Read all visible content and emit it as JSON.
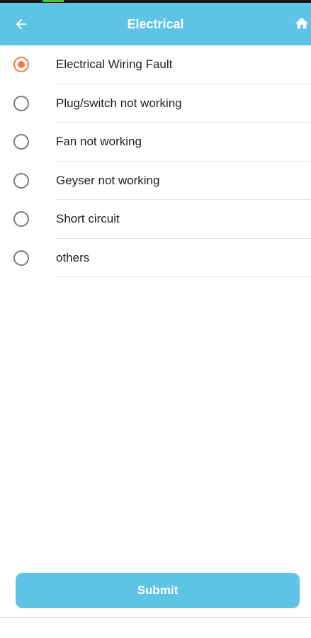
{
  "header": {
    "title": "Electrical",
    "background_color": "#5ec4e6",
    "back_icon": "arrow-left-icon",
    "home_icon": "home-icon"
  },
  "options": [
    {
      "label": "Electrical Wiring Fault",
      "selected": true
    },
    {
      "label": "Plug/switch not working",
      "selected": false
    },
    {
      "label": "Fan not working",
      "selected": false
    },
    {
      "label": "Geyser not working",
      "selected": false
    },
    {
      "label": "Short circuit",
      "selected": false
    },
    {
      "label": "others",
      "selected": false
    }
  ],
  "accent_color": "#f47c3c",
  "submit": {
    "label": "Submit"
  }
}
